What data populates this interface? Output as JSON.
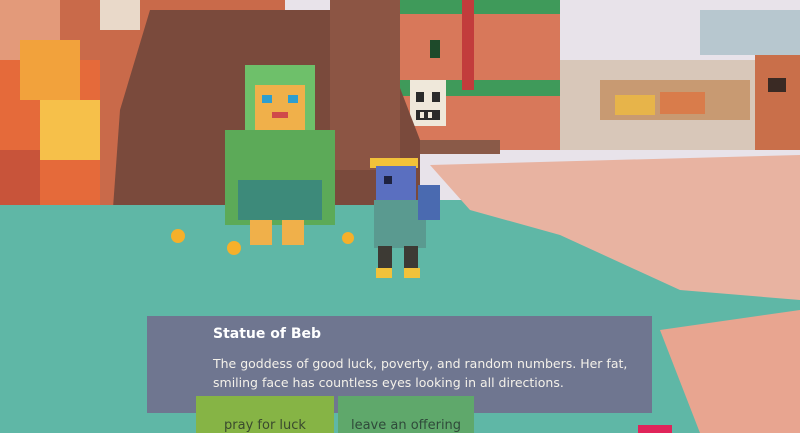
{
  "dialog": {
    "title": "Statue of Beb",
    "body": "The goddess of good luck, poverty, and random numbers. Her fat, smiling face has countless eyes looking in all directions."
  },
  "choices": [
    "pray for luck",
    "leave an offering"
  ],
  "colors": {
    "ground": "#5fb7a6",
    "dialog": "#6f7690",
    "choice_primary": "#86b445",
    "choice_secondary": "#5fa86b",
    "accent": "#e0245a"
  }
}
